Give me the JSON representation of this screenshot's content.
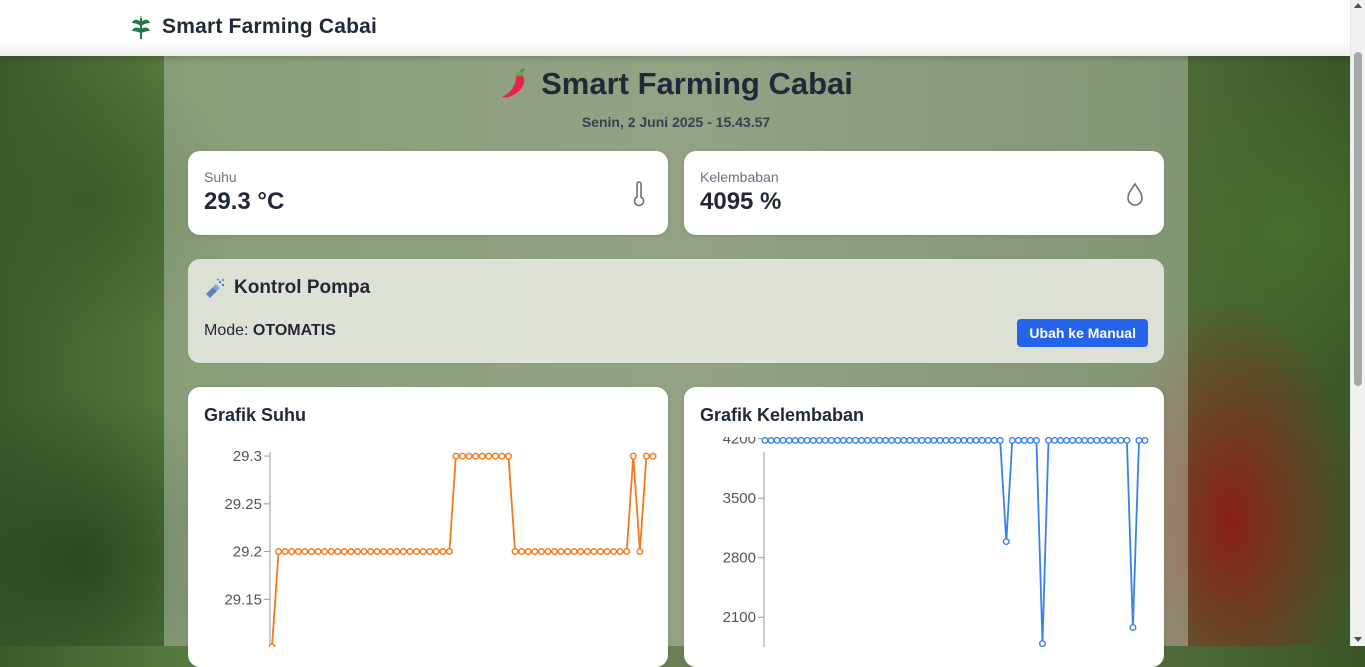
{
  "app": {
    "title": "Smart Farming Cabai"
  },
  "header": {
    "title": "Smart Farming Cabai",
    "datetime": "Senin, 2 Juni 2025 - 15.43.57"
  },
  "stats": {
    "temperature": {
      "label": "Suhu",
      "value": "29.3 °C",
      "icon": "thermometer-icon"
    },
    "humidity": {
      "label": "Kelembaban",
      "value": "4095 %",
      "icon": "water-drop-icon"
    }
  },
  "pump": {
    "title": "Kontrol Pompa",
    "mode_label": "Mode:",
    "mode_value": "OTOMATIS",
    "button_label": "Ubah ke Manual"
  },
  "colors": {
    "accent": "#2563eb",
    "temp_line": "#f07a1a",
    "humidity_line": "#3b82e6"
  },
  "chart_data": [
    {
      "type": "line",
      "title": "Grafik Suhu",
      "yticks": [
        "29.3",
        "29.25",
        "29.2",
        "29.15"
      ],
      "ylim": [
        29.1,
        29.32
      ],
      "series": [
        {
          "values": [
            29.1,
            29.2,
            29.2,
            29.2,
            29.2,
            29.2,
            29.2,
            29.2,
            29.2,
            29.2,
            29.2,
            29.2,
            29.2,
            29.2,
            29.2,
            29.2,
            29.2,
            29.2,
            29.2,
            29.2,
            29.2,
            29.2,
            29.2,
            29.2,
            29.2,
            29.2,
            29.2,
            29.2,
            29.3,
            29.3,
            29.3,
            29.3,
            29.3,
            29.3,
            29.3,
            29.3,
            29.3,
            29.2,
            29.2,
            29.2,
            29.2,
            29.2,
            29.2,
            29.2,
            29.2,
            29.2,
            29.2,
            29.2,
            29.2,
            29.2,
            29.2,
            29.2,
            29.2,
            29.2,
            29.2,
            29.3,
            29.2,
            29.3,
            29.3
          ]
        }
      ]
    },
    {
      "type": "line",
      "title": "Grafik Kelembaban",
      "yticks": [
        "4200",
        "3500",
        "2800",
        "2100"
      ],
      "ylim": [
        1750,
        4220
      ],
      "series": [
        {
          "values": [
            4180,
            4180,
            4180,
            4180,
            4180,
            4180,
            4180,
            4180,
            4180,
            4180,
            4180,
            4180,
            4180,
            4180,
            4180,
            4180,
            4180,
            4180,
            4180,
            4180,
            4180,
            4180,
            4180,
            4180,
            4180,
            4180,
            4180,
            4180,
            4180,
            4180,
            4180,
            4180,
            4180,
            4180,
            4180,
            4180,
            4180,
            4180,
            4180,
            4180,
            2990,
            4180,
            4180,
            4180,
            4180,
            4180,
            1790,
            4180,
            4180,
            4180,
            4180,
            4180,
            4180,
            4180,
            4180,
            4180,
            4180,
            4180,
            4180,
            4180,
            4180,
            1980,
            4180,
            4180
          ]
        }
      ]
    }
  ]
}
